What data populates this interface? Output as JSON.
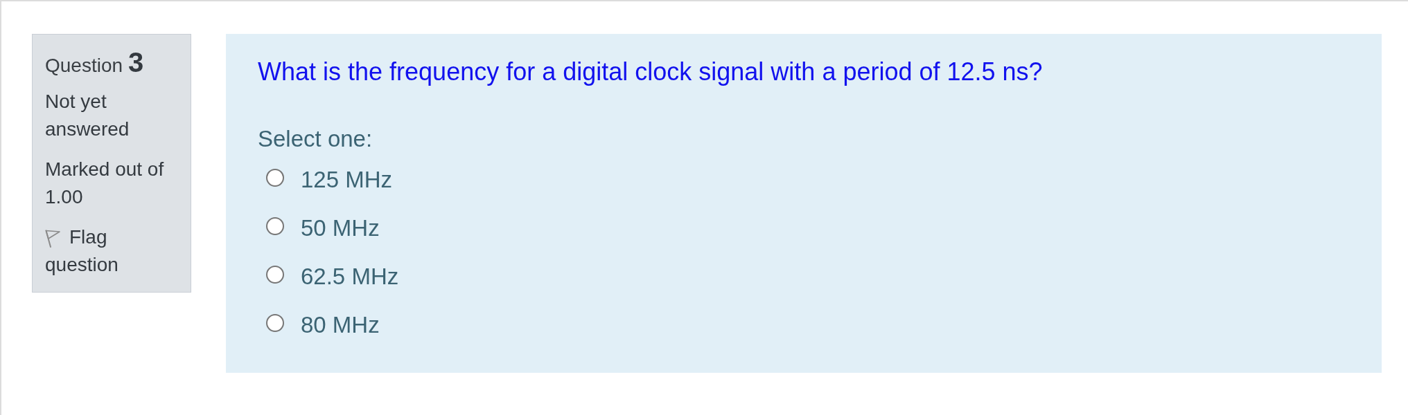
{
  "question_info": {
    "label": "Question",
    "number": "3",
    "status": "Not yet answered",
    "mark": "Marked out of 1.00",
    "flag": {
      "label": "Flag question",
      "flagged": false
    }
  },
  "question": {
    "text": "What is the frequency for a digital clock signal with a period of 12.5 ns?",
    "prompt": "Select one:",
    "options": [
      {
        "label": "125 MHz",
        "selected": false
      },
      {
        "label": "50 MHz",
        "selected": false
      },
      {
        "label": "62.5 MHz",
        "selected": false
      },
      {
        "label": "80 MHz",
        "selected": false
      }
    ]
  }
}
